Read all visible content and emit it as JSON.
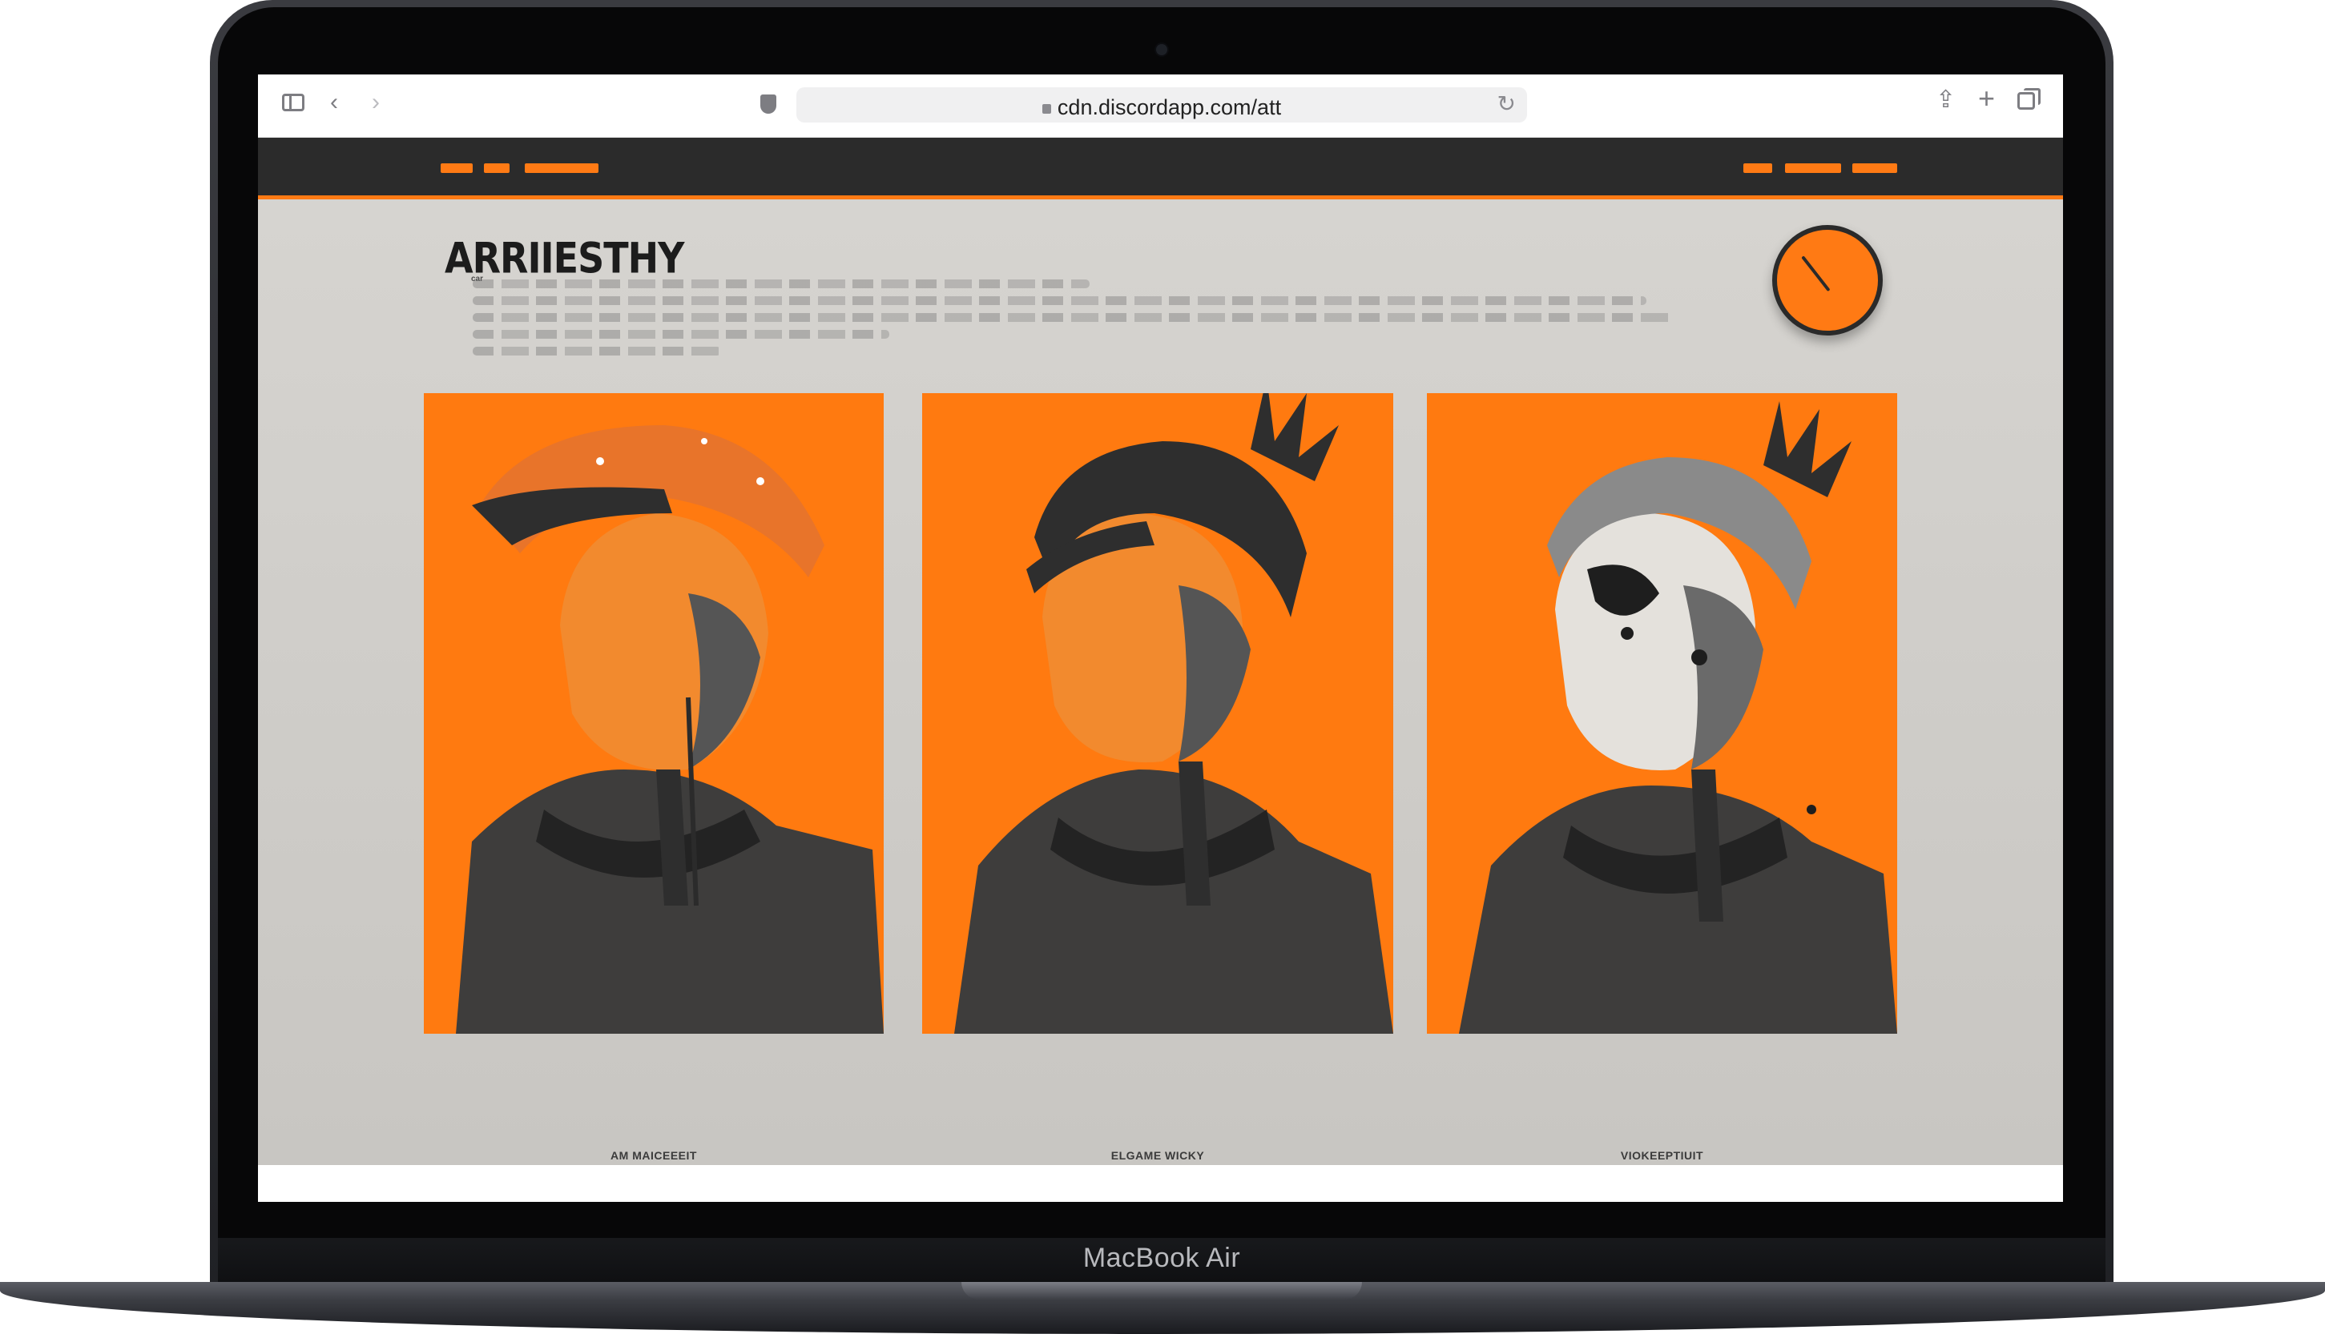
{
  "device": {
    "model_label": "MacBook Air"
  },
  "browser": {
    "url": "cdn.discordapp.com/att",
    "icons": [
      "sidebar-icon",
      "back-icon",
      "forward-icon",
      "shield-icon",
      "lock-icon",
      "reload-icon",
      "share-icon",
      "new-tab-icon",
      "tabs-icon"
    ]
  },
  "site": {
    "hero": {
      "title": "ARRIIESTHY",
      "tag": "car"
    },
    "cards": [
      {
        "caption": "AM MAICEEEIT",
        "variant": "helmet"
      },
      {
        "caption": "ELGAME WICKY",
        "variant": "headband"
      },
      {
        "caption": "VIOKEEPTIUIT",
        "variant": "painted-face"
      }
    ]
  },
  "colors": {
    "accent": "#ff7a14",
    "nav_bg": "#2b2b2b",
    "page_bg": "#d6d4d0",
    "ink": "#1c1c1c"
  }
}
